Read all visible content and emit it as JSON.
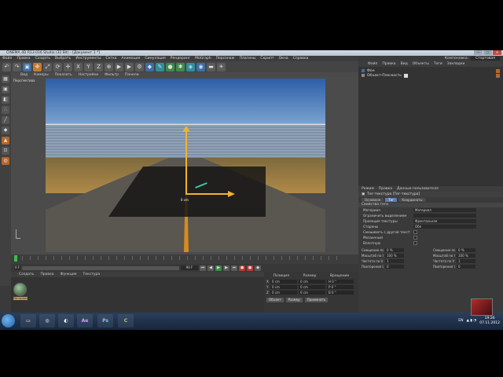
{
  "window": {
    "title": "CINEMA 4D R13.016 Studio (32 Bit) - [Документ 1 *]",
    "controls": [
      "—",
      "▢",
      "✕"
    ]
  },
  "menubar": [
    "Файл",
    "Правка",
    "Создать",
    "Выбрать",
    "Инструменты",
    "Сетка",
    "Анимация",
    "Симуляция",
    "Рендеринг",
    "MoGraph",
    "Персонаж",
    "Плагины",
    "Скрипт",
    "Окна",
    "Справка"
  ],
  "toolbar_icons": [
    "undo-icon",
    "redo-icon",
    "select-icon",
    "move-icon",
    "scale-icon",
    "rotate-icon",
    "move-icon",
    "x-axis-icon",
    "y-axis-icon",
    "z-axis-icon",
    "coord-system-icon",
    "render-view-icon",
    "render-pv-icon",
    "render-settings-icon",
    "cube-icon",
    "pen-icon",
    "subdivision-icon",
    "array-icon",
    "deformer-icon",
    "scene-icon",
    "camera-icon",
    "light-icon"
  ],
  "viewport": {
    "tabs": [
      "Вид",
      "Камеры",
      "Показать",
      "Настройки",
      "Фильтр",
      "Панели"
    ],
    "label": "Перспектива",
    "object_label": "0 cm"
  },
  "timeline": {
    "start_frame": "0 F",
    "end_frame": "90 F"
  },
  "materials": {
    "menu": [
      "Создать",
      "Правка",
      "Функция",
      "Текстура"
    ],
    "swatch_label": "Материал"
  },
  "coordinates": {
    "headers": [
      "Позиция",
      "Размер",
      "Вращение"
    ],
    "rows": [
      {
        "axis": "X",
        "pos": "0 cm",
        "size": "0 cm",
        "rot": "H 0 °"
      },
      {
        "axis": "Y",
        "pos": "0 cm",
        "size": "0 cm",
        "rot": "P 0 °"
      },
      {
        "axis": "Z",
        "pos": "0 cm",
        "size": "0 cm",
        "rot": "B 0 °"
      }
    ],
    "mode": "Объект",
    "size_mode": "Размер",
    "apply": "Применить"
  },
  "right_panel": {
    "layout_label": "Компоновка:",
    "layout_value": "Стартовая",
    "objects_menu": [
      "Файл",
      "Правка",
      "Вид",
      "Объекты",
      "Теги",
      "Закладки"
    ],
    "objects": [
      {
        "name": "Фон"
      },
      {
        "name": "Объект-Плоскость"
      }
    ],
    "attributes_menu": [
      "Режим",
      "Правка",
      "Данные пользователя"
    ],
    "attributes_title": "Тег-текстура [Тег-текстура]",
    "attribute_tabs": [
      "Основное",
      "Тег",
      "Координаты"
    ],
    "section": "Свойства тега",
    "attributes": [
      {
        "label": "Материал",
        "value": "Материал"
      },
      {
        "label": "Ограничить выделением",
        "value": ""
      },
      {
        "label": "Проекция текстуры",
        "value": "Фронтальная"
      },
      {
        "label": "Стороны",
        "value": "Обе"
      }
    ],
    "checks": [
      {
        "label": "Смешивать с другой текстурой"
      },
      {
        "label": "Мозаичный"
      },
      {
        "label": "Вплотную"
      }
    ],
    "grid": [
      {
        "label": "Смещение по U",
        "value": "0 %"
      },
      {
        "label": "Смещение по V",
        "value": "0 %"
      },
      {
        "label": "Масштаб по U",
        "value": "100 %"
      },
      {
        "label": "Масштаб по V",
        "value": "100 %"
      },
      {
        "label": "Частота по U",
        "value": "1"
      },
      {
        "label": "Частота по V",
        "value": "1"
      },
      {
        "label": "Повторения U",
        "value": "0"
      },
      {
        "label": "Повторения V",
        "value": "0"
      }
    ]
  },
  "taskbar": {
    "apps": [
      "Ae",
      "Ps"
    ],
    "lang": "EN",
    "time": "19:26",
    "date": "07.11.2012"
  }
}
